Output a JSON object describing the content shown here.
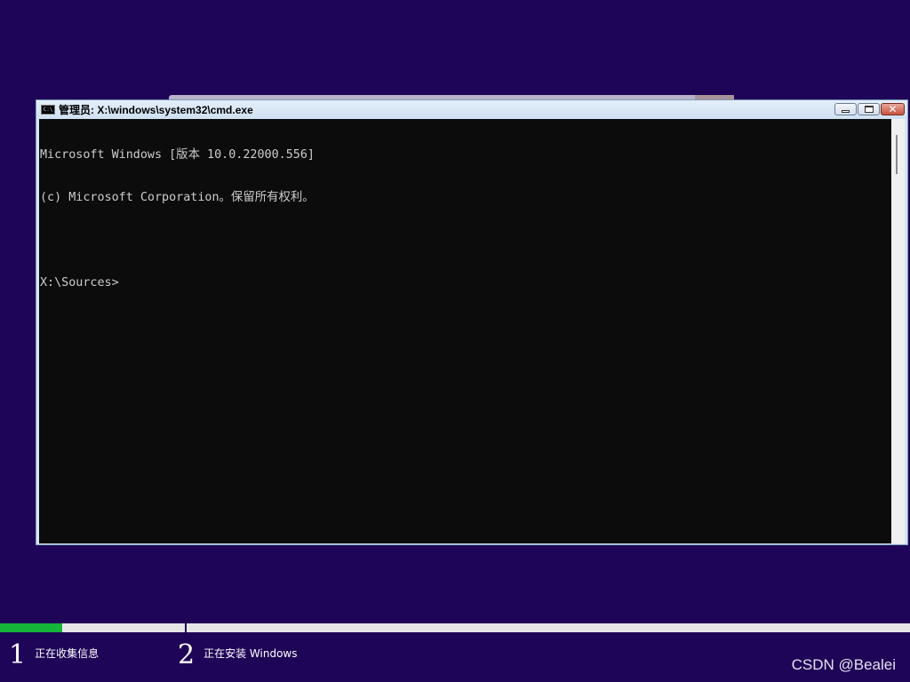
{
  "window": {
    "title": "管理员: X:\\windows\\system32\\cmd.exe",
    "icon": "cmd-icon",
    "icon_text": "C:\\",
    "minimize_icon": "minimize-icon",
    "maximize_icon": "maximize-icon",
    "close_icon": "close-icon",
    "close_label": "✕"
  },
  "console": {
    "lines": [
      "Microsoft Windows [版本 10.0.22000.556]",
      "(c) Microsoft Corporation。保留所有权利。",
      "",
      "X:\\Sources>"
    ],
    "background": "#0c0c0c",
    "foreground": "#cccccc"
  },
  "setup": {
    "progress_percent": 6.8,
    "steps": [
      {
        "number": "1",
        "label": "正在收集信息"
      },
      {
        "number": "2",
        "label": "正在安装 Windows"
      }
    ],
    "progress_color": "#15b43a",
    "background_color": "#1f0557"
  },
  "watermark": "CSDN @Bealei"
}
